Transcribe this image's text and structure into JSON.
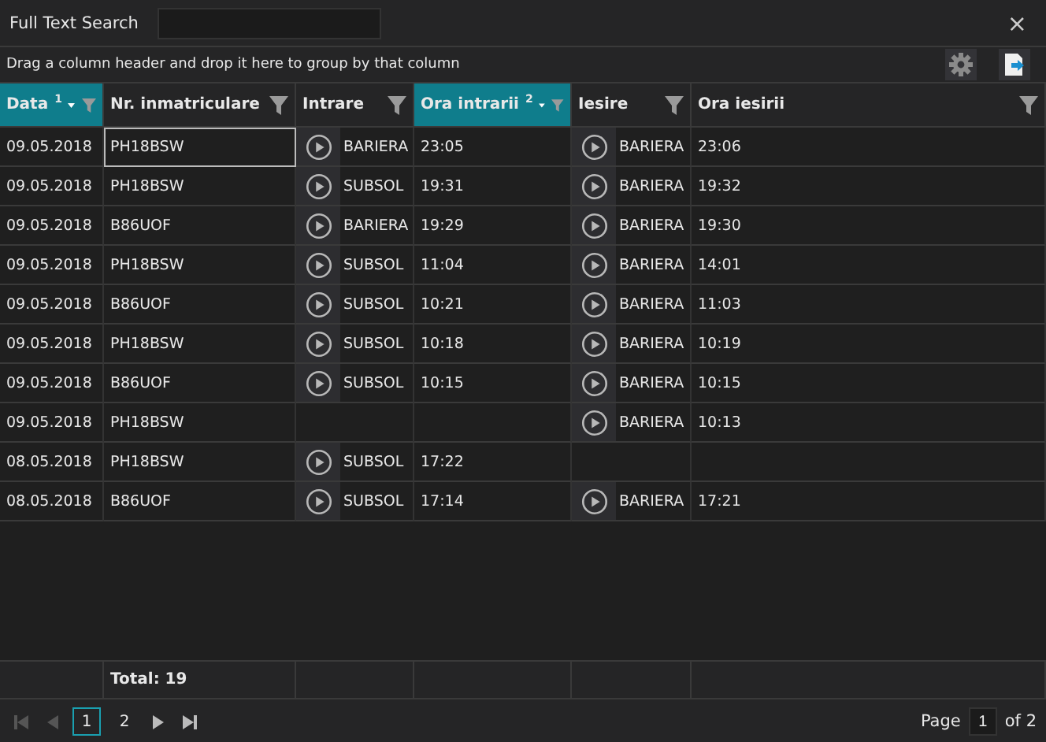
{
  "search": {
    "label": "Full Text Search"
  },
  "close": "×",
  "group_panel": {
    "hint": "Drag a column header and drop it here to group by that column"
  },
  "columns": [
    {
      "label": "Data",
      "sorted": true,
      "sort_order": "1"
    },
    {
      "label": "Nr. inmatriculare",
      "sorted": false
    },
    {
      "label": "Intrare",
      "sorted": false
    },
    {
      "label": "Ora intrarii",
      "sorted": true,
      "sort_order": "2"
    },
    {
      "label": "Iesire",
      "sorted": false
    },
    {
      "label": "Ora iesirii",
      "sorted": false
    }
  ],
  "rows": [
    {
      "date": "09.05.2018",
      "plate": "PH18BSW",
      "entry_gate": "BARIERA",
      "entry_time": "23:05",
      "exit_gate": "BARIERA",
      "exit_time": "23:06",
      "current": true
    },
    {
      "date": "09.05.2018",
      "plate": "PH18BSW",
      "entry_gate": "SUBSOL",
      "entry_time": "19:31",
      "exit_gate": "BARIERA",
      "exit_time": "19:32",
      "current": false
    },
    {
      "date": "09.05.2018",
      "plate": "B86UOF",
      "entry_gate": "BARIERA",
      "entry_time": "19:29",
      "exit_gate": "BARIERA",
      "exit_time": "19:30",
      "current": false
    },
    {
      "date": "09.05.2018",
      "plate": "PH18BSW",
      "entry_gate": "SUBSOL",
      "entry_time": "11:04",
      "exit_gate": "BARIERA",
      "exit_time": "14:01",
      "current": false
    },
    {
      "date": "09.05.2018",
      "plate": "B86UOF",
      "entry_gate": "SUBSOL",
      "entry_time": "10:21",
      "exit_gate": "BARIERA",
      "exit_time": "11:03",
      "current": false
    },
    {
      "date": "09.05.2018",
      "plate": "PH18BSW",
      "entry_gate": "SUBSOL",
      "entry_time": "10:18",
      "exit_gate": "BARIERA",
      "exit_time": "10:19",
      "current": false
    },
    {
      "date": "09.05.2018",
      "plate": "B86UOF",
      "entry_gate": "SUBSOL",
      "entry_time": "10:15",
      "exit_gate": "BARIERA",
      "exit_time": "10:15",
      "current": false
    },
    {
      "date": "09.05.2018",
      "plate": "PH18BSW",
      "exit_gate": "BARIERA",
      "exit_time": "10:13",
      "current": false
    },
    {
      "date": "08.05.2018",
      "plate": "PH18BSW",
      "entry_gate": "SUBSOL",
      "entry_time": "17:22",
      "current": false
    },
    {
      "date": "08.05.2018",
      "plate": "B86UOF",
      "entry_gate": "SUBSOL",
      "entry_time": "17:14",
      "exit_gate": "BARIERA",
      "exit_time": "17:21",
      "current": false
    }
  ],
  "footer": {
    "total": "Total: 19"
  },
  "pager": {
    "pages": [
      {
        "label": "1",
        "selected": true
      },
      {
        "label": "2",
        "selected": false
      }
    ],
    "page_label": "Page",
    "page_value": "1",
    "of_label": "of 2"
  }
}
